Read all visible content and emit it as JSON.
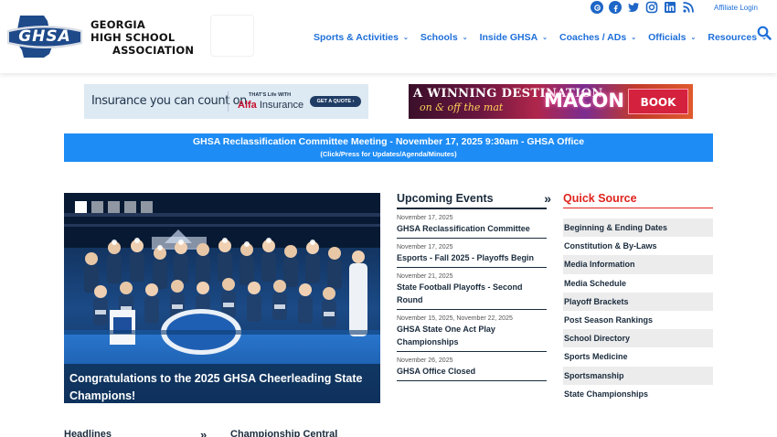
{
  "header": {
    "logo_lettering": "GHSA",
    "org_name": [
      "GEORGIA",
      "HIGH SCHOOL",
      "ASSOCIATION"
    ],
    "affiliate_login": "Affiliate Login",
    "social_icons": [
      "threads-icon",
      "facebook-icon",
      "twitter-icon",
      "instagram-icon",
      "linkedin-icon",
      "rss-icon"
    ],
    "nav": [
      {
        "label": "Sports & Activities"
      },
      {
        "label": "Schools"
      },
      {
        "label": "Inside GHSA"
      },
      {
        "label": "Coaches / ADs"
      },
      {
        "label": "Officials"
      },
      {
        "label": "Resources"
      }
    ]
  },
  "ads": {
    "alfa": {
      "tagline": "Insurance you can count on.",
      "small": "THAT'S Life WITH",
      "brand": "Alfa",
      "brand_suffix": " Insurance",
      "cta": "GET A QUOTE ›"
    },
    "macon": {
      "line1": "A WINNING DESTINATION",
      "line2": "on & off the mat",
      "brand": "MACON",
      "cta": "BOOK NOW!"
    }
  },
  "banner": {
    "title": "GHSA Reclassification Committee Meeting - November 17, 2025 9:30am - GHSA Office",
    "subtitle": "(Click/Press for Updates/Agenda/Minutes)"
  },
  "hero": {
    "caption": "Congratulations to the 2025 GHSA Cheerleading State Champions!",
    "slide_count": 5,
    "active_slide": 1
  },
  "events": {
    "title": "Upcoming Events",
    "arrows": "»",
    "items": [
      {
        "date": "November 17, 2025",
        "name": "GHSA Reclassification Committee"
      },
      {
        "date": "November 17, 2025",
        "name": "Esports - Fall 2025 - Playoffs Begin"
      },
      {
        "date": "November 21, 2025",
        "name": "State Football Playoffs - Second Round"
      },
      {
        "date": "November 15, 2025, November 22, 2025",
        "name": "GHSA State One Act Play Championships"
      },
      {
        "date": "November 26, 2025",
        "name": "GHSA Office Closed"
      }
    ]
  },
  "quick_source": {
    "title": "Quick Source",
    "items": [
      "Beginning & Ending Dates",
      "Constitution & By-Laws",
      "Media Information",
      "Media Schedule",
      "Playoff Brackets",
      "Post Season Rankings",
      "School Directory",
      "Sports Medicine",
      "Sportsmanship",
      "State Championships"
    ]
  },
  "bottom": {
    "headlines": "Headlines",
    "arrows": "»",
    "championship": "Championship Central"
  },
  "colors": {
    "accent_blue": "#1e6fd9",
    "banner_blue": "#1e8cf5",
    "quick_red": "#e0231d",
    "navy": "#1a2b3c"
  }
}
